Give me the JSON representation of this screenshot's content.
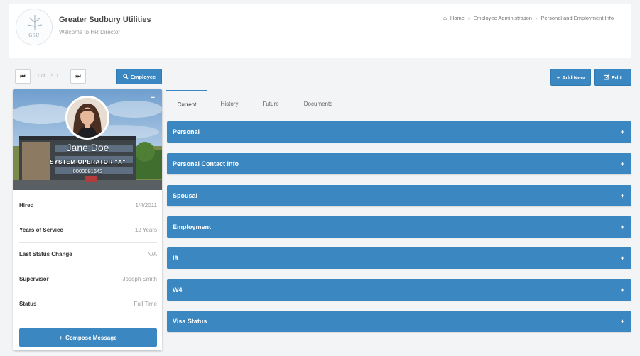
{
  "header": {
    "logo_text": "GSU",
    "org_name": "Greater Sudbury Utilities",
    "welcome": "Welcome to HR Director"
  },
  "breadcrumb": {
    "items": [
      "Home",
      "Employee Administration",
      "Personal and Employment Info"
    ]
  },
  "navigator": {
    "first_label": "⏮",
    "position": "1 of 1,511",
    "next_label": "⏭"
  },
  "toolbar": {
    "search_label": "Employee",
    "add_label": "Add New",
    "edit_label": "Edit"
  },
  "employee": {
    "collapse_label": "−",
    "name": "Jane Doe",
    "title": "SYSTEM OPERATOR \"A\"",
    "id": "0000091642"
  },
  "info_rows": [
    {
      "label": "Hired",
      "value": "1/4/2011"
    },
    {
      "label": "Years of Service",
      "value": "12 Years"
    },
    {
      "label": "Last Status Change",
      "value": "N/A"
    },
    {
      "label": "Supervisor",
      "value": "Joseph Smith"
    },
    {
      "label": "Status",
      "value": "Full Time"
    }
  ],
  "compose_label": "Compose Message",
  "tabs": [
    {
      "label": "Current",
      "active": true
    },
    {
      "label": "History",
      "active": false
    },
    {
      "label": "Future",
      "active": false
    },
    {
      "label": "Documents",
      "active": false
    }
  ],
  "sections": [
    {
      "label": "Personal"
    },
    {
      "label": "Personal Contact Info"
    },
    {
      "label": "Spousal"
    },
    {
      "label": "Employment"
    },
    {
      "label": "I9"
    },
    {
      "label": "W4"
    },
    {
      "label": "Visa Status"
    }
  ],
  "icons": {
    "home": "home-icon",
    "search": "search-icon",
    "plus": "plus-icon",
    "edit": "edit-icon"
  },
  "colors": {
    "accent": "#3a87c2",
    "background": "#f3f4f6"
  }
}
